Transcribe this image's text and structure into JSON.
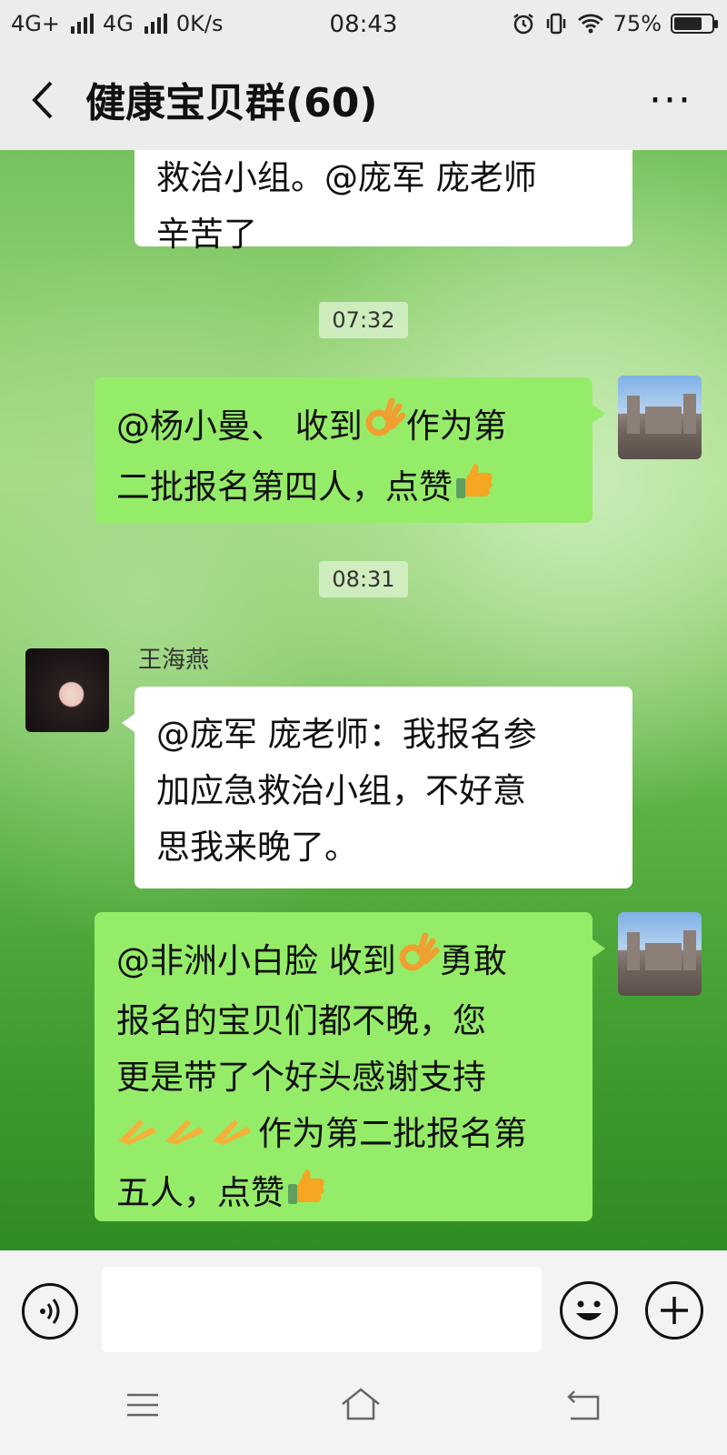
{
  "status_bar": {
    "network1": "4G+",
    "network2": "4G",
    "speed": "0K/s",
    "time": "08:43",
    "battery_percent": "75%",
    "battery_level": 0.75
  },
  "header": {
    "title": "健康宝贝群(60)",
    "back_icon": "chevron-left-icon",
    "more_icon": "more-dots-icon"
  },
  "messages": {
    "m0": {
      "side": "left",
      "lines": [
        "救治小组。@庞军  庞老师",
        "辛苦了"
      ]
    },
    "t1": "07:32",
    "m1": {
      "side": "right",
      "lines": [
        "@杨小曼、 收到",
        "作为第",
        "二批报名第四人，点赞"
      ]
    },
    "t2": "08:31",
    "m2": {
      "side": "left",
      "sender": "王海燕",
      "lines": [
        "@庞军  庞老师：我报名参",
        "加应急救治小组，不好意",
        "思我来晚了。"
      ]
    },
    "m3": {
      "side": "right",
      "lines": [
        "@非洲小白脸  收到",
        "勇敢",
        "报名的宝贝们都不晚，您",
        "更是带了个好头感谢支持",
        "作为第二批报名第",
        "五人，点赞"
      ]
    }
  },
  "input_bar": {
    "placeholder": "",
    "voice_icon": "voice-icon",
    "emoji_icon": "smiley-icon",
    "plus_icon": "plus-icon"
  },
  "nav_bar": {
    "menu_icon": "menu-icon",
    "home_icon": "home-icon",
    "back_icon": "return-icon"
  },
  "colors": {
    "bubble_self": "#95ec69",
    "bubble_other": "#ffffff",
    "bar_bg": "#ececec"
  }
}
